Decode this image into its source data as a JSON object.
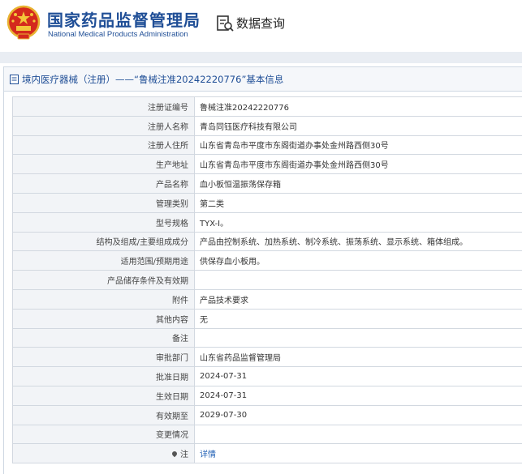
{
  "header": {
    "org_cn": "国家药品监督管理局",
    "org_en": "National Medical Products Administration",
    "query_title": "数据查询",
    "emblem_icon": "national-emblem-icon",
    "query_icon": "document-search-icon"
  },
  "panel": {
    "title": "境内医疗器械（注册）——“鲁械注准20242220776”基本信息"
  },
  "rows": [
    {
      "label": "注册证编号",
      "value": "鲁械注准20242220776"
    },
    {
      "label": "注册人名称",
      "value": "青岛同钰医疗科技有限公司"
    },
    {
      "label": "注册人住所",
      "value": "山东省青岛市平度市东阁街道办事处金州路西侧30号"
    },
    {
      "label": "生产地址",
      "value": "山东省青岛市平度市东阁街道办事处金州路西侧30号"
    },
    {
      "label": "产品名称",
      "value": "血小板恒温振荡保存箱"
    },
    {
      "label": "管理类别",
      "value": "第二类"
    },
    {
      "label": "型号规格",
      "value": "TYX-Ⅰ。"
    },
    {
      "label": "结构及组成/主要组成成分",
      "value": "产品由控制系统、加热系统、制冷系统、振荡系统、显示系统、箱体组成。"
    },
    {
      "label": "适用范围/预期用途",
      "value": "供保存血小板用。"
    },
    {
      "label": "产品储存条件及有效期",
      "value": ""
    },
    {
      "label": "附件",
      "value": "产品技术要求"
    },
    {
      "label": "其他内容",
      "value": "无"
    },
    {
      "label": "备注",
      "value": ""
    },
    {
      "label": "审批部门",
      "value": "山东省药品监督管理局"
    },
    {
      "label": "批准日期",
      "value": "2024-07-31"
    },
    {
      "label": "生效日期",
      "value": "2024-07-31"
    },
    {
      "label": "有效期至",
      "value": "2029-07-30"
    },
    {
      "label": "变更情况",
      "value": ""
    }
  ],
  "note_row": {
    "label": "注",
    "link": "详情",
    "icon": "pin-icon"
  },
  "colors": {
    "brand_blue": "#1f4e96",
    "link_blue": "#1f5fb4",
    "label_bg": "#f2f4f7",
    "border": "#d2d8e0"
  }
}
